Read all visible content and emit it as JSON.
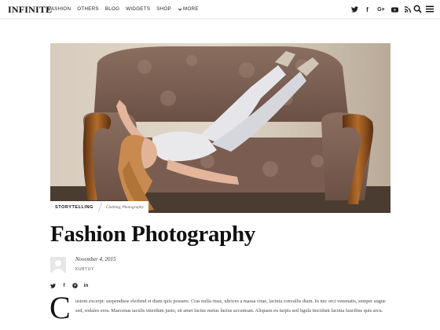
{
  "header": {
    "logo": "INFINITE",
    "nav": [
      {
        "label": "FASHION"
      },
      {
        "label": "OTHERS"
      },
      {
        "label": "BLOG"
      },
      {
        "label": "WIDGETS"
      },
      {
        "label": "SHOP"
      },
      {
        "label": "MORE",
        "icon": "chevron-down-icon"
      }
    ],
    "social_icons": [
      "twitter-icon",
      "facebook-icon",
      "google-plus-icon",
      "youtube-icon",
      "rss-icon"
    ],
    "social_glyphs": {
      "facebook": "f",
      "gplus": "G+"
    }
  },
  "post": {
    "category": "STORYTELLING",
    "tags": "Clothing, Photography",
    "title": "Fashion Photography",
    "date": "November 4, 2015",
    "author": "KUBTUY",
    "share_icons": [
      "twitter-icon",
      "facebook-icon",
      "pinterest-icon",
      "linkedin-icon"
    ],
    "share_glyphs": {
      "facebook": "f",
      "linkedin": "in"
    },
    "dropcap": "C",
    "excerpt": "ustom excerpt: suspendisse eleifend et diam quis posuere. Cras nulla risus, ultrices a massa vitae, lacinia convallis diam. In nec orci venenatis, semper augue sed, sodales eros. Maecenas iaculis interdum justo, sit amet luctus metus luctus accumsan. Aliquam eu turpis sed ligula tincidunt lacinia faucibus quis arcu."
  }
}
